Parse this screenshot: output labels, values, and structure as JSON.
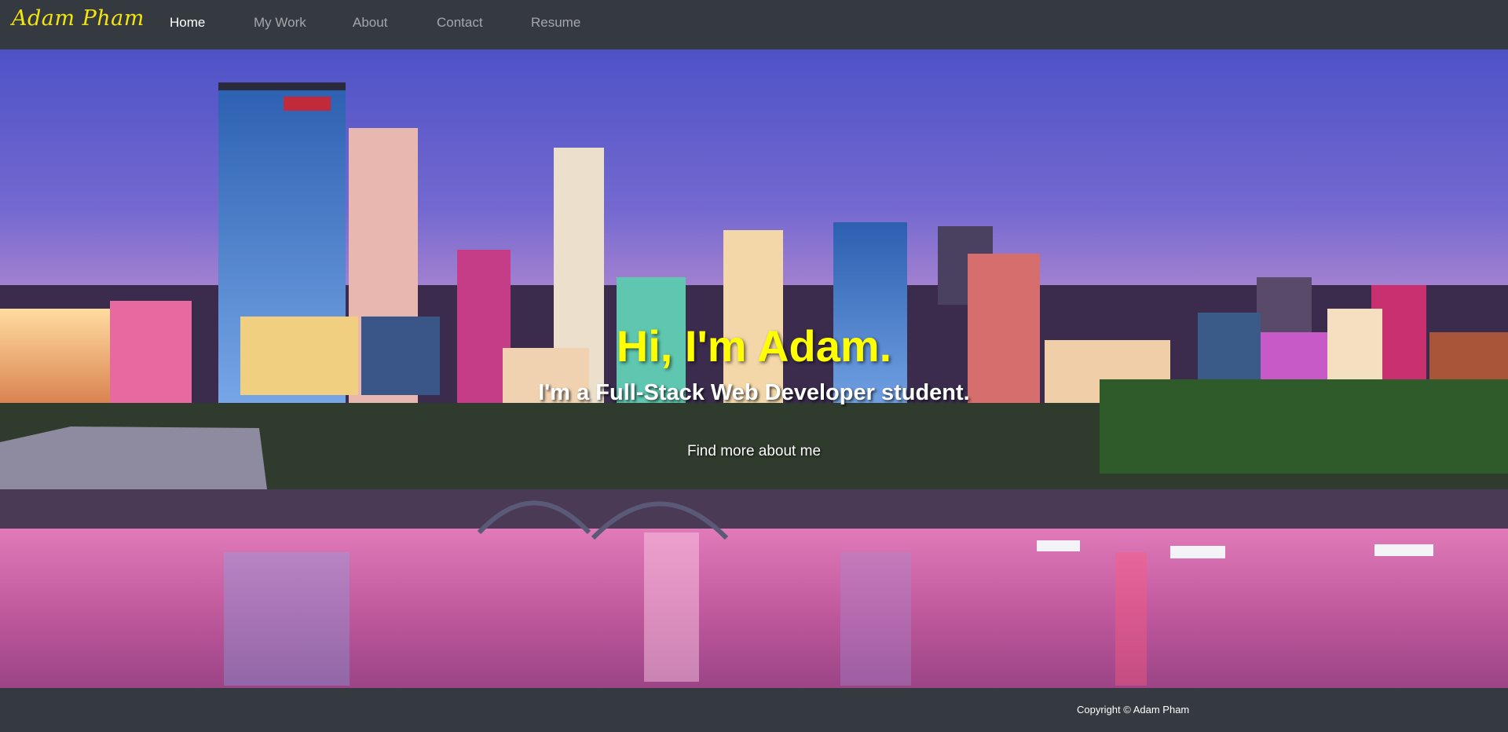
{
  "navbar": {
    "brand": "Adam Pham",
    "links": [
      {
        "label": "Home",
        "active": true
      },
      {
        "label": "My Work",
        "active": false
      },
      {
        "label": "About",
        "active": false
      },
      {
        "label": "Contact",
        "active": false
      },
      {
        "label": "Resume",
        "active": false
      }
    ]
  },
  "hero": {
    "title": "Hi, I'm Adam.",
    "subtitle": "I'm a Full-Stack Web Developer student.",
    "link_label": "Find more about me",
    "background": "city-skyline-night-photo"
  },
  "footer": {
    "copyright": "Copyright © Adam Pham"
  },
  "colors": {
    "navbar_bg": "#343a40",
    "brand": "#f5e50f",
    "title": "#ffff00",
    "nav_inactive": "rgba(255,255,255,0.55)"
  }
}
